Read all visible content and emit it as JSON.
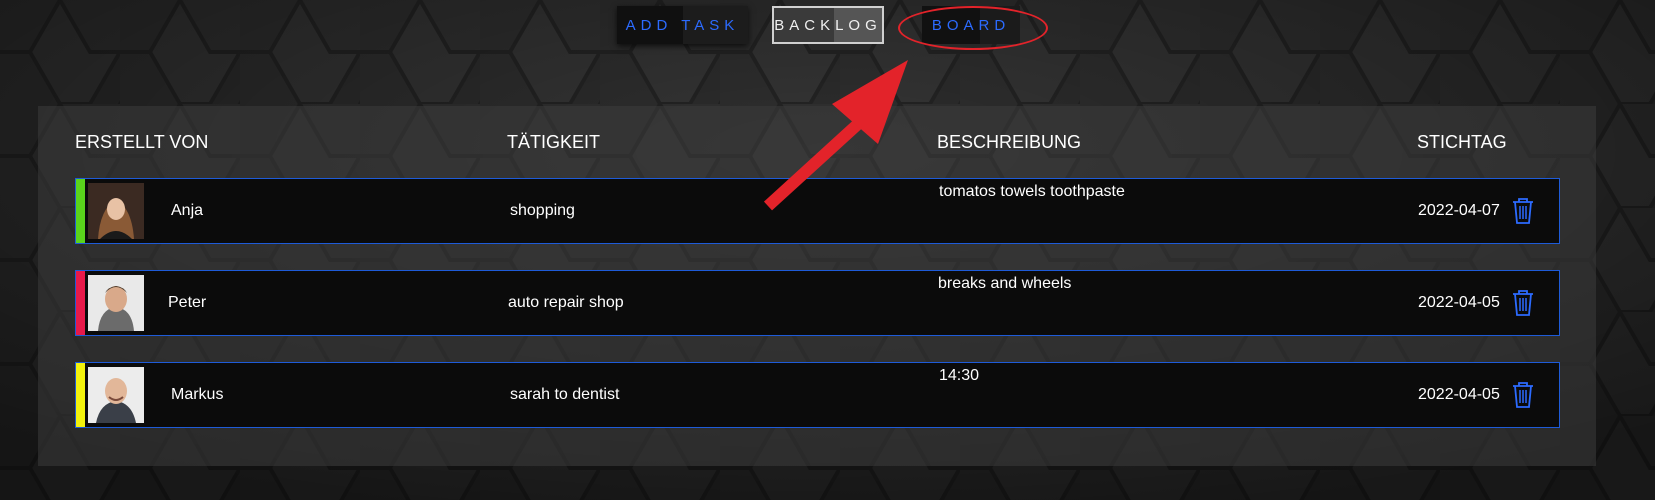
{
  "nav": {
    "add_task": "ADD TASK",
    "backlog": "BACKLOG",
    "board": "BOARD"
  },
  "table": {
    "headers": [
      "ERSTELLT VON",
      "TÄTIGKEIT",
      "BESCHREIBUNG",
      "STICHTAG"
    ],
    "rows": [
      {
        "creator": "Anja",
        "activity": "shopping",
        "description": "tomatos towels toothpaste",
        "due": "2022-04-07",
        "accent_color": "#5ad41c"
      },
      {
        "creator": "Peter",
        "activity": "auto repair shop",
        "description": "breaks and wheels",
        "due": "2022-04-05",
        "accent_color": "#e8194a"
      },
      {
        "creator": "Markus",
        "activity": "sarah to dentist",
        "description": "14:30",
        "due": "2022-04-05",
        "accent_color": "#f2f20d"
      }
    ]
  },
  "colors": {
    "accent_blue": "#2c6bff",
    "row_border": "#1e5bd8",
    "annotation_red": "#e3232a"
  },
  "icons": {
    "delete": "trash-icon"
  }
}
